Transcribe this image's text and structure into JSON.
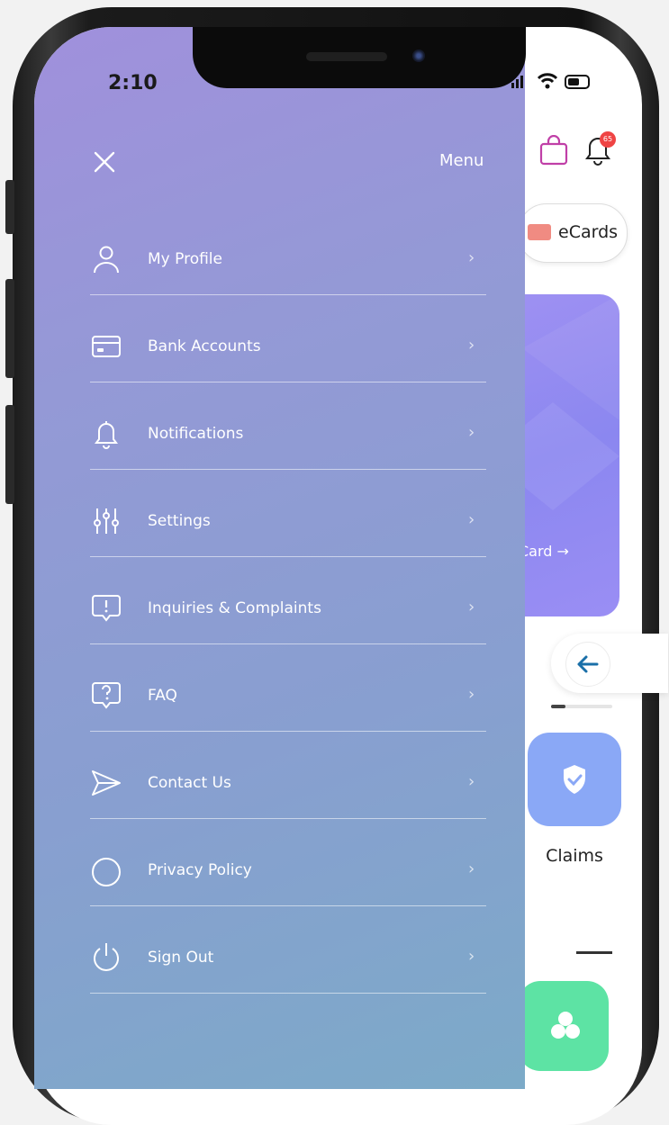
{
  "status": {
    "time": "2:10"
  },
  "drawer": {
    "title": "Menu",
    "items": [
      {
        "label": "My Profile",
        "icon": "user-icon"
      },
      {
        "label": "Bank Accounts",
        "icon": "bank-card-icon"
      },
      {
        "label": "Notifications",
        "icon": "bell-icon"
      },
      {
        "label": "Settings",
        "icon": "sliders-icon"
      },
      {
        "label": "Inquiries & Complaints",
        "icon": "exclamation-bubble-icon"
      },
      {
        "label": "FAQ",
        "icon": "question-bubble-icon"
      },
      {
        "label": "Contact Us",
        "icon": "send-icon"
      },
      {
        "label": "Privacy Policy",
        "icon": "circle-icon"
      },
      {
        "label": "Sign Out",
        "icon": "power-icon"
      }
    ]
  },
  "background": {
    "notification_count": "65",
    "ecards_label": "eCards",
    "card_partial_text": "Card →",
    "claims_label": "Claims"
  },
  "colors": {
    "accent": "#9b8df0",
    "claims_tile": "#8aa8f6",
    "green_tile": "#5de3a4",
    "badge": "#ef4444",
    "arrow": "#1a6fa8"
  }
}
